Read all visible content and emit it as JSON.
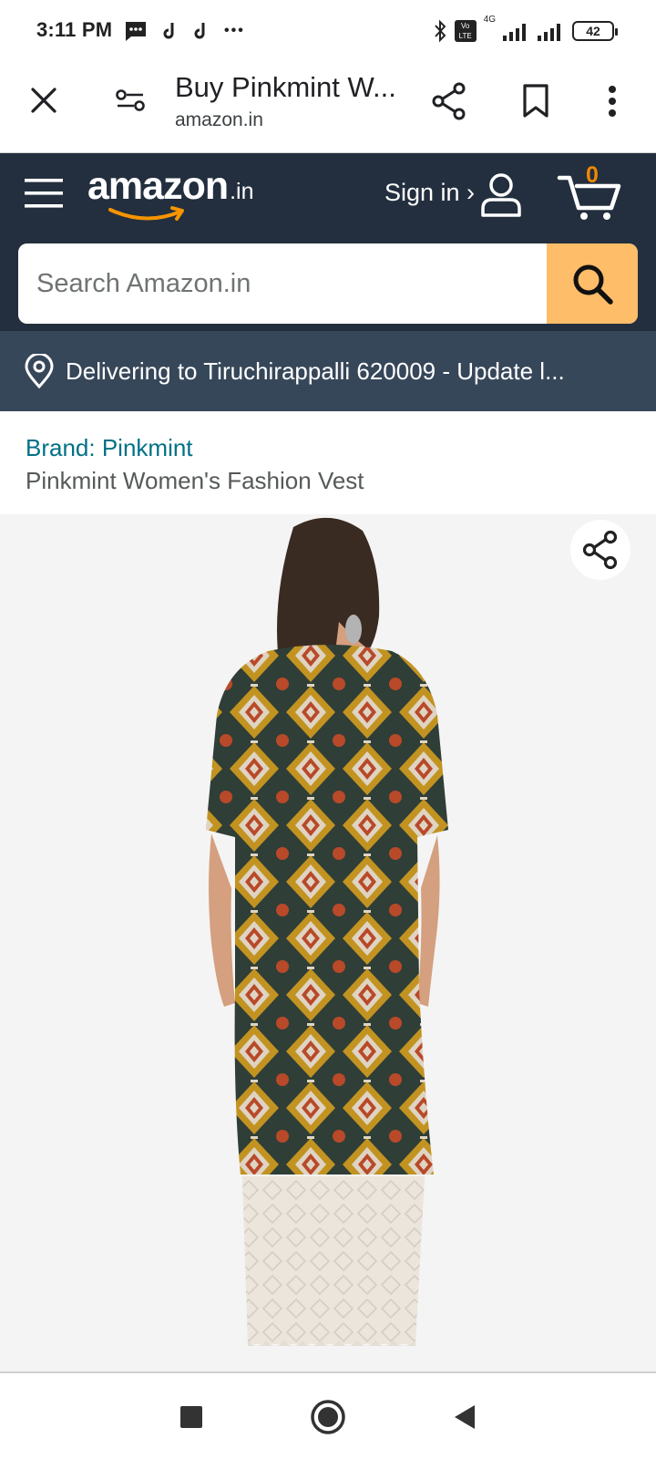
{
  "status_bar": {
    "time": "3:11 PM",
    "network_label": "4G",
    "volte_label": "Vo LTE",
    "battery": "42",
    "more_dots": "•••"
  },
  "tab": {
    "title": "Buy Pinkmint W...",
    "domain": "amazon.in"
  },
  "header": {
    "logo_text": "amazon",
    "logo_tld": ".in",
    "signin_label": "Sign in ›",
    "cart_count": "0"
  },
  "search": {
    "placeholder": "Search Amazon.in"
  },
  "delivery": {
    "text": "Delivering to Tiruchirappalli 620009 - Update l..."
  },
  "product": {
    "brand_link": "Brand: Pinkmint",
    "title": "Pinkmint Women's Fashion Vest"
  },
  "colors": {
    "header_bg": "#232f3e",
    "delivery_bg": "#37475a",
    "search_button": "#febd69",
    "cart_badge": "#f08804",
    "brand_link": "#007185"
  }
}
